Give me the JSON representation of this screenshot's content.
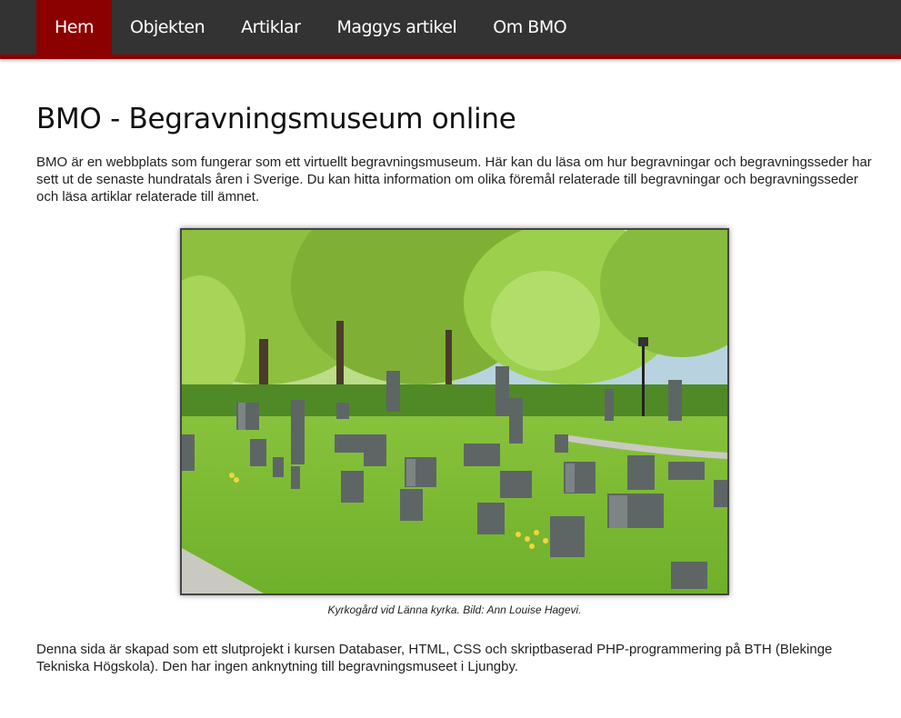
{
  "nav": {
    "items": [
      {
        "label": "Hem",
        "active": true
      },
      {
        "label": "Objekten",
        "active": false
      },
      {
        "label": "Artiklar",
        "active": false
      },
      {
        "label": "Maggys artikel",
        "active": false
      },
      {
        "label": "Om BMO",
        "active": false
      }
    ]
  },
  "main": {
    "title": "BMO - Begravningsmuseum online",
    "intro": "BMO är en webbplats som fungerar som ett virtuellt begravningsmuseum. Här kan du läsa om hur begravningar och begravningsseder har sett ut de senaste hundratals åren i Sverige. Du kan hitta information om olika föremål relaterade till begravningar och begravningsseder och läsa artiklar relaterade till ämnet.",
    "figure": {
      "caption": "Kyrkogård vid Länna kyrka. Bild: Ann Louise Hagevi."
    },
    "footer_text": "Denna sida är skapad som ett slutprojekt i kursen Databaser, HTML, CSS och skriptbaserad PHP-programmering på BTH (Blekinge Tekniska Högskola). Den har ingen anknytning till begravningsmuseet i Ljungby."
  },
  "colors": {
    "nav_background": "#333333",
    "nav_active": "#8b0000",
    "nav_border": "#8b0000",
    "text": "#222222"
  }
}
